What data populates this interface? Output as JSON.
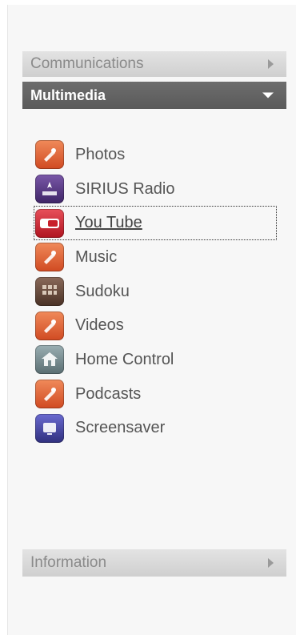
{
  "sections": {
    "communications": {
      "label": "Communications"
    },
    "multimedia": {
      "label": "Multimedia"
    },
    "information": {
      "label": "Information"
    }
  },
  "menu": {
    "items": [
      {
        "label": "Photos",
        "icon": "photos-icon",
        "color": "#e0643a"
      },
      {
        "label": "SIRIUS Radio",
        "icon": "sirius-radio-icon",
        "color": "#5a3a80"
      },
      {
        "label": "You Tube",
        "icon": "youtube-icon",
        "color": "#c8202a"
      },
      {
        "label": "Music",
        "icon": "music-icon",
        "color": "#e0643a"
      },
      {
        "label": "Sudoku",
        "icon": "sudoku-icon",
        "color": "#6a4a3a"
      },
      {
        "label": "Videos",
        "icon": "videos-icon",
        "color": "#e0643a"
      },
      {
        "label": "Home Control",
        "icon": "home-control-icon",
        "color": "#7a8e92"
      },
      {
        "label": "Podcasts",
        "icon": "podcasts-icon",
        "color": "#e0643a"
      },
      {
        "label": "Screensaver",
        "icon": "screensaver-icon",
        "color": "#4a4aa8"
      }
    ]
  }
}
